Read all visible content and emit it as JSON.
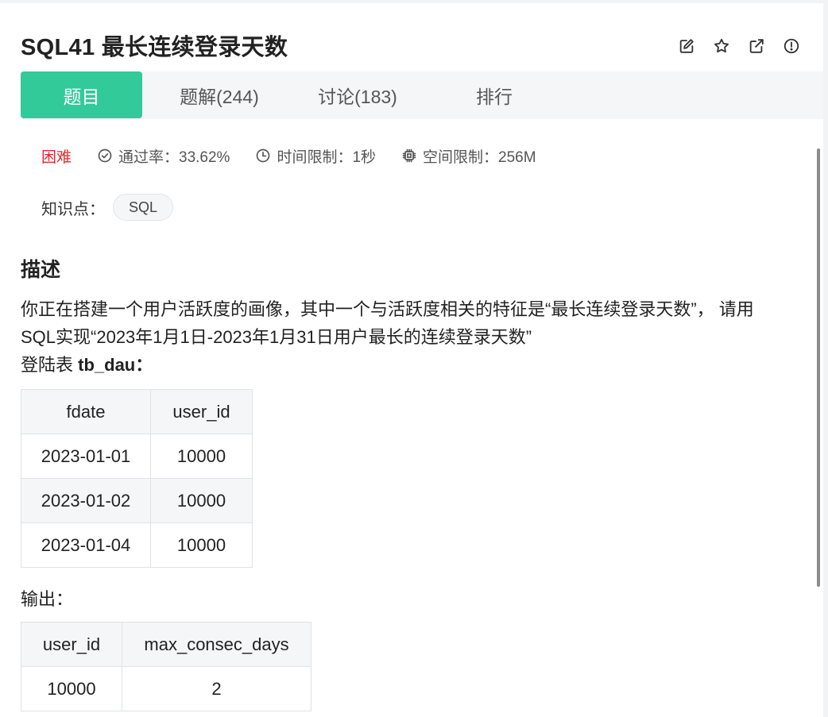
{
  "problem": {
    "title": "SQL41  最长连续登录天数"
  },
  "title_actions": [
    {
      "icon": "edit-icon"
    },
    {
      "icon": "star-icon"
    },
    {
      "icon": "share-icon"
    },
    {
      "icon": "report-icon"
    }
  ],
  "tabs": [
    {
      "label": "题目",
      "active": true
    },
    {
      "label": "题解(244)",
      "active": false
    },
    {
      "label": "讨论(183)",
      "active": false
    },
    {
      "label": "排行",
      "active": false
    }
  ],
  "meta": {
    "difficulty": "困难",
    "pass_rate": "通过率：33.62%",
    "time_limit": "时间限制：1秒",
    "space_limit": "空间限制：256M"
  },
  "knowledge": {
    "label": "知识点：",
    "tags": [
      "SQL"
    ]
  },
  "description": {
    "heading": "描述",
    "line1": "你正在搭建一个用户活跃度的画像，其中一个与活跃度相关的特征是“最长连续登录天数”， 请用",
    "line2": "SQL实现“2023年1月1日-2023年1月31日用户最长的连续登录天数”",
    "table_label_prefix": "登陆表 ",
    "table_label_name": "tb_dau",
    "table_label_suffix": "："
  },
  "login_table": {
    "headers": [
      "fdate",
      "user_id"
    ],
    "rows": [
      [
        "2023-01-01",
        "10000"
      ],
      [
        "2023-01-02",
        "10000"
      ],
      [
        "2023-01-04",
        "10000"
      ]
    ]
  },
  "output": {
    "label": "输出：",
    "headers": [
      "user_id",
      "max_consec_days"
    ],
    "rows": [
      [
        "10000",
        "2"
      ]
    ]
  },
  "colors": {
    "accent": "#32ca99",
    "difficulty_hard": "#e02a2a"
  }
}
